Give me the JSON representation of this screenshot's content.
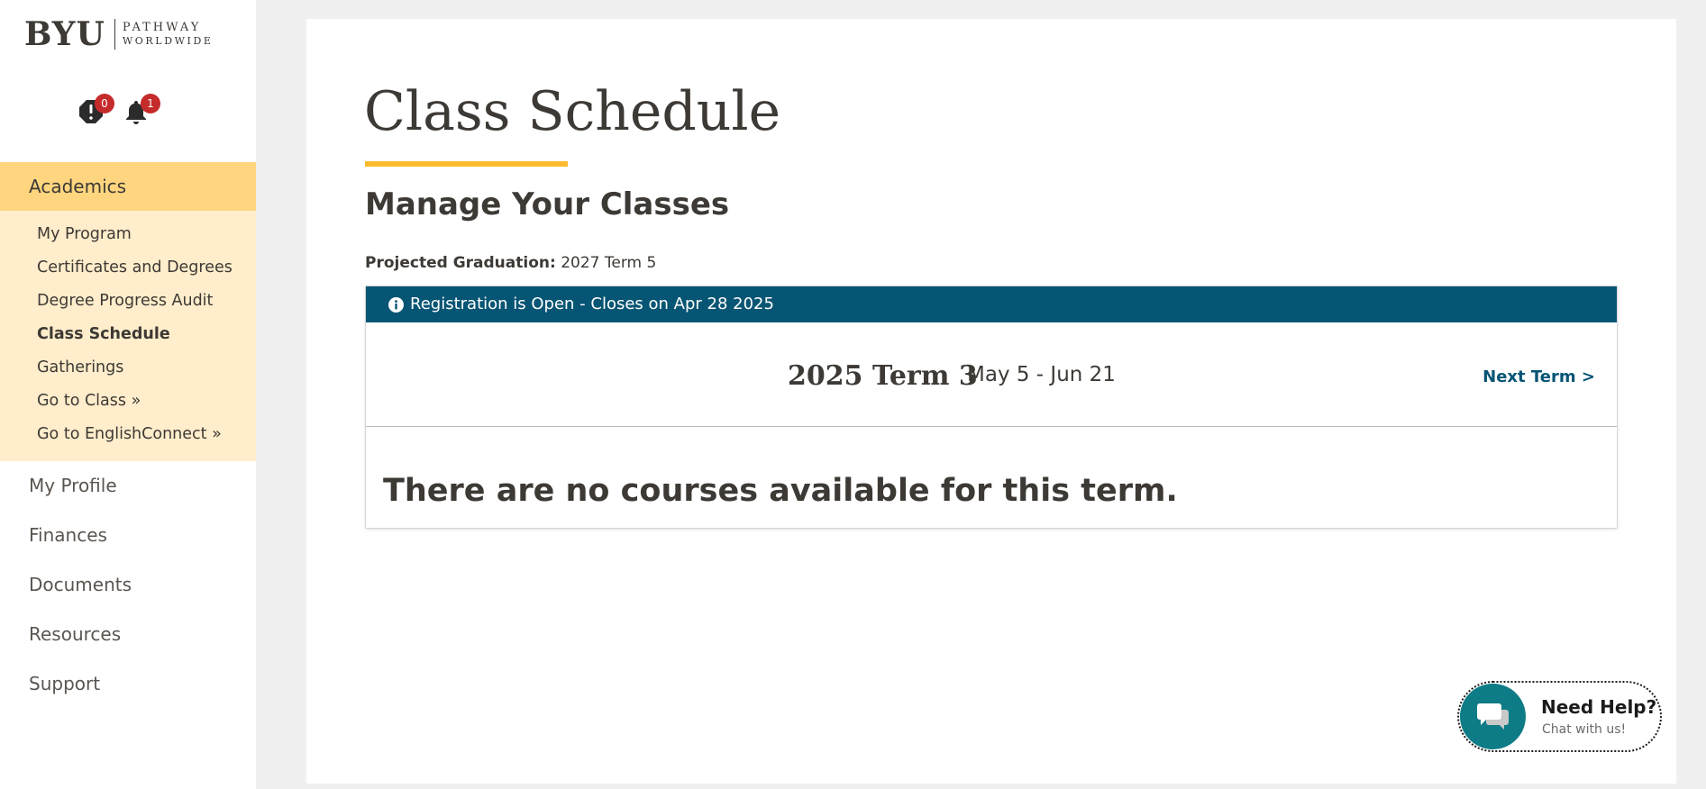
{
  "brand": {
    "logo_main": "BYU",
    "logo_line1": "PATHWAY",
    "logo_line2": "WORLDWIDE"
  },
  "notifications": {
    "alerts_count": "0",
    "bell_count": "1",
    "alerts_icon": "alert-octagon-icon",
    "bell_icon": "bell-icon"
  },
  "sidebar": {
    "active_section": "Academics",
    "subitems": [
      {
        "label": "My Program"
      },
      {
        "label": "Certificates and Degrees"
      },
      {
        "label": "Degree Progress Audit"
      },
      {
        "label": "Class Schedule",
        "current": true
      },
      {
        "label": "Gatherings"
      },
      {
        "label": "Go to Class »"
      },
      {
        "label": "Go to EnglishConnect »"
      }
    ],
    "sections": [
      {
        "label": "My Profile"
      },
      {
        "label": "Finances"
      },
      {
        "label": "Documents"
      },
      {
        "label": "Resources"
      },
      {
        "label": "Support"
      }
    ]
  },
  "main": {
    "title": "Class Schedule",
    "subtitle": "Manage Your Classes",
    "projected_label": "Projected Graduation:",
    "projected_value": "2027 Term 5",
    "registration_text": "Registration is Open - Closes on Apr 28 2025",
    "term_name": "2025 Term 3",
    "term_dates": "May 5 - Jun 21",
    "next_term": "Next Term >",
    "empty_message": "There are no courses available for this term."
  },
  "chat": {
    "title": "Need Help?",
    "subtitle": "Chat with us!",
    "icon": "chat-bubbles-icon"
  },
  "colors": {
    "accent_yellow": "#fcbb2f",
    "nav_active": "#ffd67f",
    "subnav_bg": "#ffedcb",
    "banner_blue": "#075574",
    "badge_red": "#c62b2b",
    "chat_teal": "#0e7c86"
  }
}
